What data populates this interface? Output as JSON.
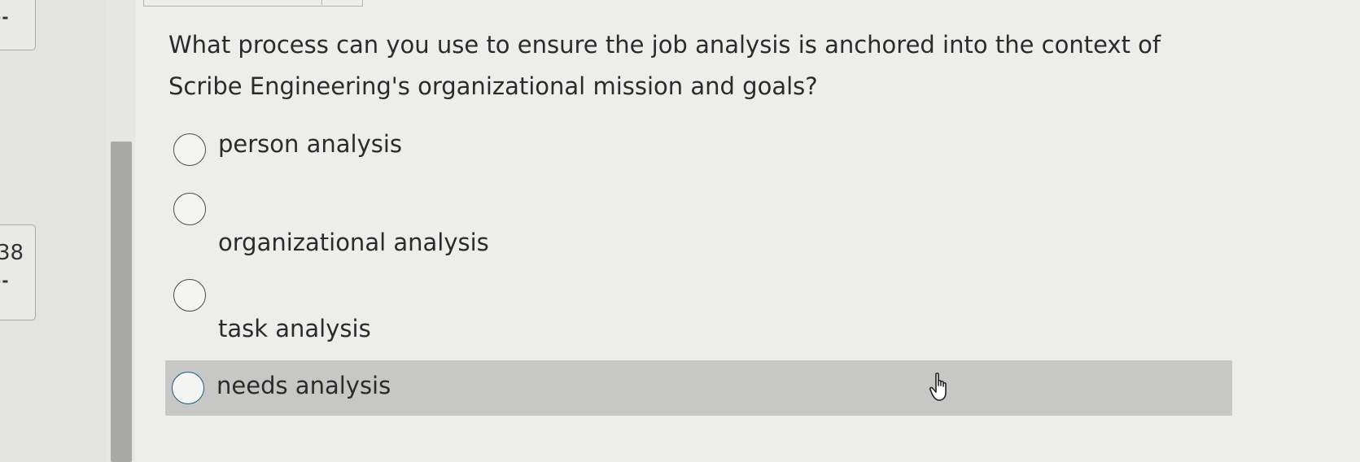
{
  "question": {
    "text": "What process can you use to ensure the job analysis is anchored into the context of Scribe Engineering's organizational mission and goals?"
  },
  "options": [
    {
      "label": "person analysis",
      "selected": false
    },
    {
      "label": "organizational analysis",
      "selected": false
    },
    {
      "label": "task analysis",
      "selected": false
    },
    {
      "label": "needs analysis",
      "selected": false,
      "hovered": true
    }
  ],
  "nav": {
    "top_marker": "--",
    "mid_number": "38",
    "mid_marker": "--"
  },
  "cursor": {
    "icon": "hand-pointer-icon"
  },
  "colors": {
    "page_bg": "#ededeb",
    "hover_bg": "#c7c7c5",
    "hover_radio_border": "#1f5a7a",
    "text": "#2b2b2b"
  }
}
